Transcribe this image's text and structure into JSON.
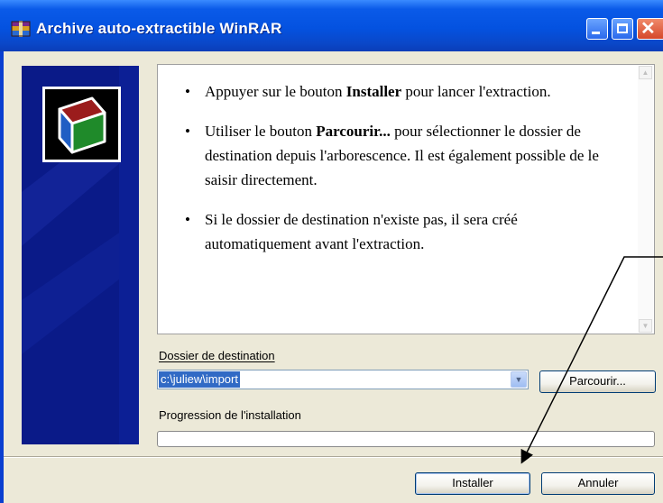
{
  "window": {
    "title": "Archive auto-extractible WinRAR",
    "icon": "winrar-archive-icon",
    "controls": [
      "minimize-icon",
      "maximize-icon",
      "close-icon"
    ]
  },
  "instructions": [
    {
      "text_before": "Appuyer sur le bouton ",
      "bold": "Installer",
      "text_after": " pour lancer l'extraction."
    },
    {
      "text_before": "Utiliser le bouton ",
      "bold": "Parcourir...",
      "text_after": " pour sélectionner le dossier de destination depuis l'arborescence. Il est également possible de le saisir directement."
    },
    {
      "text_before": "",
      "bold": "",
      "text_after": "Si le dossier de destination n'existe pas, il sera créé automatiquement avant l'extraction."
    }
  ],
  "destination": {
    "label": "Dossier de destination",
    "value": "c:\\juliew\\import"
  },
  "browse_button": "Parcourir...",
  "progress": {
    "label": "Progression de l'installation",
    "value": 0
  },
  "buttons": {
    "install": "Installer",
    "cancel": "Annuler"
  },
  "colors": {
    "titlebar": "#0452e0",
    "banner": "#0a1e92",
    "selection": "#316ac5",
    "face": "#ece9d8"
  }
}
